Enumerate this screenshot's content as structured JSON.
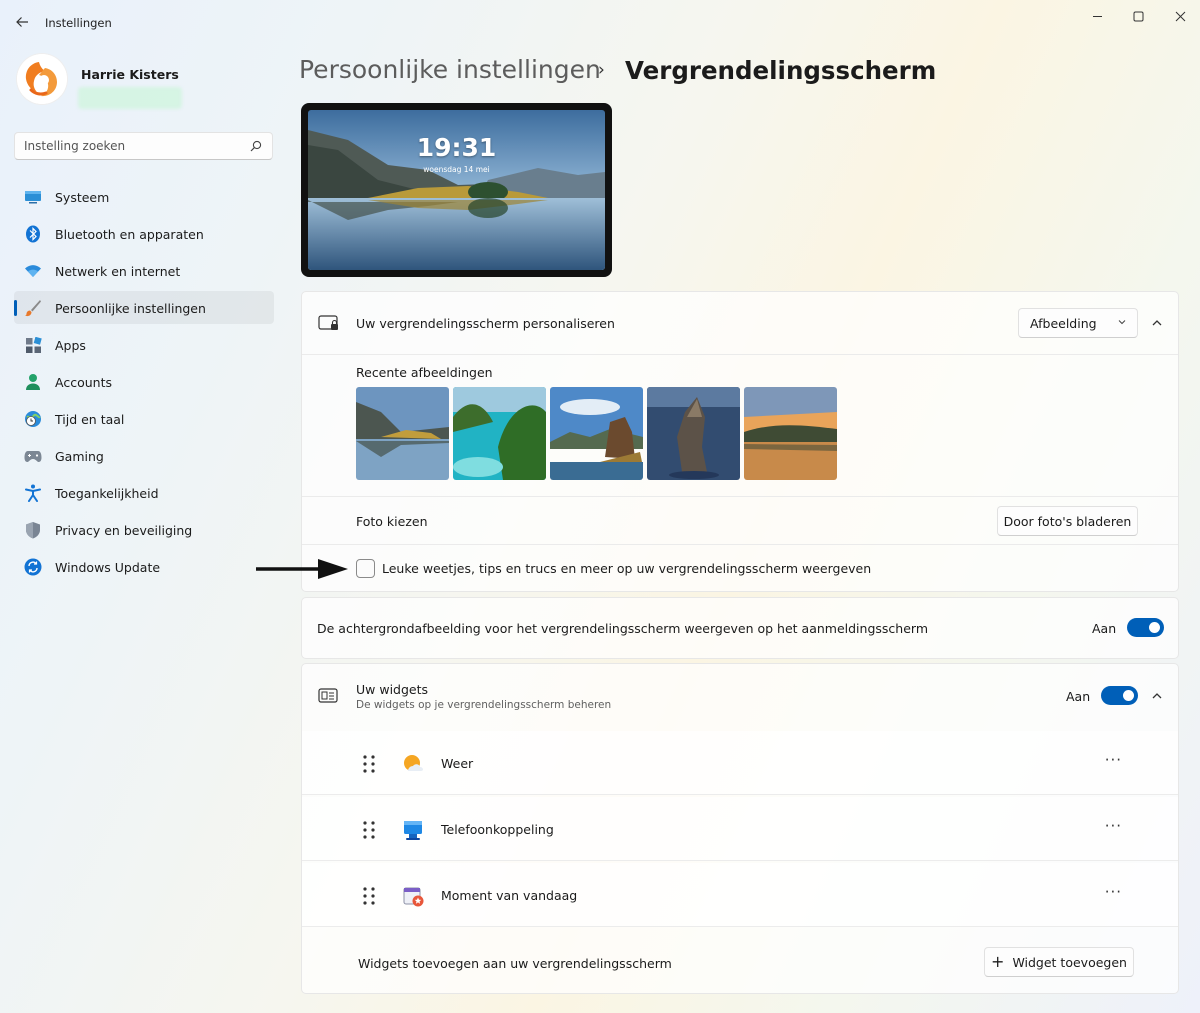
{
  "window": {
    "app_title": "Instellingen",
    "back_icon": "arrow-left-icon",
    "minimize_glyph": "—",
    "maximize_glyph": "☐",
    "close_glyph": "✕"
  },
  "user": {
    "name": "Harrie Kisters"
  },
  "search": {
    "placeholder": "Instelling zoeken"
  },
  "sidebar": {
    "items": [
      {
        "label": "Systeem",
        "icon": "monitor-icon"
      },
      {
        "label": "Bluetooth en apparaten",
        "icon": "bluetooth-icon"
      },
      {
        "label": "Netwerk en internet",
        "icon": "wifi-icon"
      },
      {
        "label": "Persoonlijke instellingen",
        "icon": "paintbrush-icon",
        "active": true
      },
      {
        "label": "Apps",
        "icon": "apps-icon"
      },
      {
        "label": "Accounts",
        "icon": "person-icon"
      },
      {
        "label": "Tijd en taal",
        "icon": "globe-clock-icon"
      },
      {
        "label": "Gaming",
        "icon": "gamepad-icon"
      },
      {
        "label": "Toegankelijkheid",
        "icon": "accessibility-icon"
      },
      {
        "label": "Privacy en beveiliging",
        "icon": "shield-icon"
      },
      {
        "label": "Windows Update",
        "icon": "update-icon"
      }
    ]
  },
  "breadcrumb": {
    "parent": "Persoonlijke instellingen",
    "separator": "›",
    "current": "Vergrendelingsscherm"
  },
  "preview": {
    "time": "19:31",
    "date": "woensdag 14 mei"
  },
  "personalize": {
    "label": "Uw vergrendelingsscherm personaliseren",
    "dropdown_value": "Afbeelding",
    "recent_label": "Recente afbeeldingen",
    "choose_photo_label": "Foto kiezen",
    "browse_button": "Door foto's bladeren",
    "tips_label": "Leuke weetjes, tips en trucs en meer op uw vergrendelingsscherm weergeven",
    "tips_checked": false
  },
  "signin_background": {
    "label": "De achtergrondafbeelding voor het vergrendelingsscherm weergeven op het aanmeldingsscherm",
    "state_label": "Aan",
    "on": true
  },
  "widgets": {
    "title": "Uw widgets",
    "subtitle": "De widgets op je vergrendelingsscherm beheren",
    "state_label": "Aan",
    "on": true,
    "items": [
      {
        "label": "Weer",
        "icon": "weather-icon"
      },
      {
        "label": "Telefoonkoppeling",
        "icon": "phone-link-icon"
      },
      {
        "label": "Moment van vandaag",
        "icon": "calendar-star-icon"
      }
    ],
    "more_glyph": "···",
    "add_label": "Widgets toevoegen aan uw vergrendelingsscherm",
    "add_button": "Widget toevoegen",
    "add_glyph": "+"
  },
  "colors": {
    "accent": "#005fb8"
  }
}
